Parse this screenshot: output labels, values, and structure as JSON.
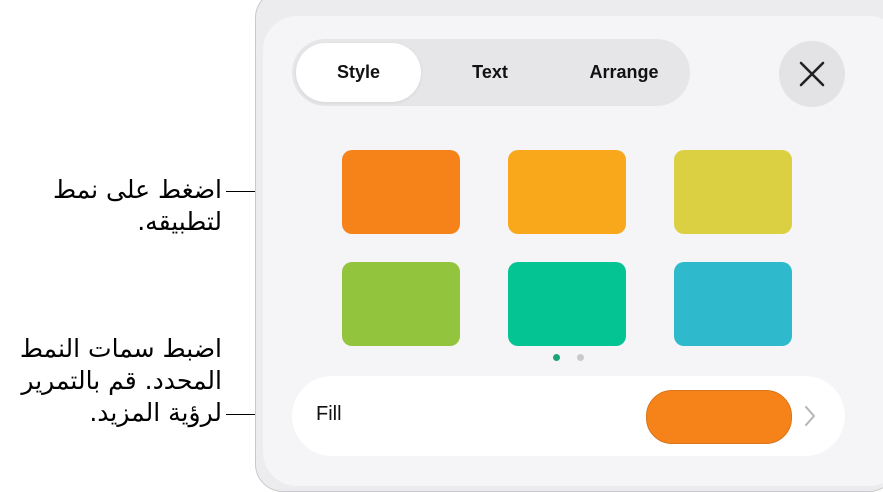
{
  "callouts": {
    "apply_style": [
      "اضغط على نمط",
      "لتطبيقه."
    ],
    "adjust_attributes": [
      "اضبط سمات النمط",
      "المحدد. قم بالتمرير",
      "لرؤية المزيد."
    ]
  },
  "tabs": {
    "style": "Style",
    "text": "Text",
    "arrange": "Arrange",
    "selected": "Style"
  },
  "close_icon": "close-icon",
  "swatches": [
    {
      "name": "orange",
      "color": "#f58319"
    },
    {
      "name": "amber",
      "color": "#f9a81b"
    },
    {
      "name": "yellow",
      "color": "#dbcf42"
    },
    {
      "name": "green",
      "color": "#92c43d"
    },
    {
      "name": "teal",
      "color": "#05c494"
    },
    {
      "name": "cyan",
      "color": "#2fb9cc"
    }
  ],
  "page_indicator": {
    "current": 1,
    "total": 2
  },
  "fill": {
    "label": "Fill",
    "color": "#f58319",
    "chevron_icon": "chevron-right-icon"
  }
}
